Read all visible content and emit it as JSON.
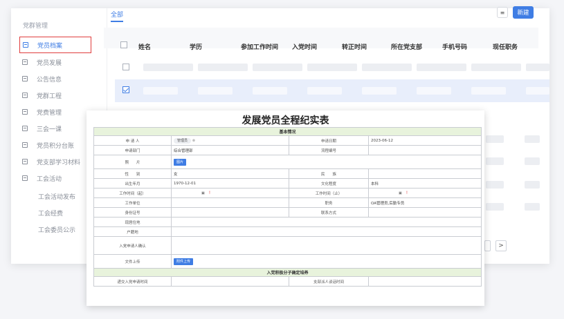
{
  "sidebar": {
    "title": "党群管理",
    "items": [
      {
        "label": "党员档案"
      },
      {
        "label": "党员发展"
      },
      {
        "label": "公告信息"
      },
      {
        "label": "党群工程"
      },
      {
        "label": "党费管理"
      },
      {
        "label": "三会一课"
      },
      {
        "label": "党员积分台账"
      },
      {
        "label": "党支部学习材料"
      },
      {
        "label": "工会活动"
      }
    ],
    "sub_items": [
      {
        "label": "工会活动发布"
      },
      {
        "label": "工会经费"
      },
      {
        "label": "工会委员公示"
      }
    ]
  },
  "toolbar": {
    "tab_all": "全部",
    "new_label": "新建",
    "tool_icon": "≡"
  },
  "table": {
    "columns": [
      "姓名",
      "学历",
      "参加工作时间",
      "入党时间",
      "转正时间",
      "所在党支部",
      "手机号码",
      "现任职务"
    ]
  },
  "pager": {
    "next": ">"
  },
  "form": {
    "title": "发展党员全程纪实表",
    "section1": "基本情况",
    "section2": "入党积极分子确定培养",
    "applicant_label": "申 请 人",
    "applicant_value": "管理员",
    "apply_date_label": "申请日期",
    "apply_date_value": "2023-06-12",
    "dept_label": "申请部门",
    "dept_value": "综合管理部",
    "flow_label": "流程编号",
    "photo_label": "照　　片",
    "photo_btn": "图片",
    "gender_label": "性　　别",
    "gender_value": "女",
    "ethnic_label": "民　　族",
    "birth_label": "出生年月",
    "birth_value": "1970-12-01",
    "edu_label": "文化程度",
    "edu_value": "本科",
    "work_start_label": "工作时间（起）",
    "work_end_label": "工作时间（止）",
    "unit_label": "工作单位",
    "post_label": "职务",
    "post_value": "OA管理员,后勤专员",
    "id_label": "身份证号",
    "contact_label": "联系方式",
    "address_label": "现居住地",
    "domicile_label": "户籍地",
    "confirm_label": "入党申请人确认",
    "upload_label": "文件上传",
    "upload_btn": "附件上传",
    "submit_time_label": "递交入党申请时间",
    "talk_time_label": "支部派人谈话时间",
    "req_mark": "!"
  },
  "colors": {
    "accent": "#3f7de4",
    "highlight": "#e03c3c",
    "section_bg": "#e8f3dc"
  }
}
